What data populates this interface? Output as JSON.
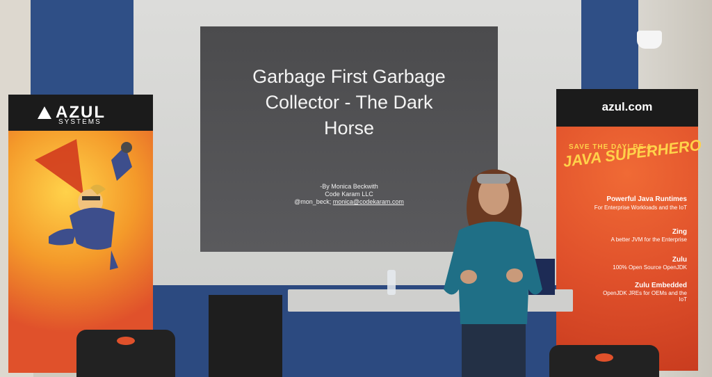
{
  "slide": {
    "title_lines": [
      "Garbage First Garbage",
      "Collector - The Dark",
      "Horse"
    ],
    "byline": "-By Monica Beckwith",
    "company": "Code Karam LLC",
    "handle": "@mon_beck; ",
    "email": "monica@codekaram.com"
  },
  "banner_left": {
    "logo": "AZUL",
    "logo_sub": "SYSTEMS"
  },
  "banner_right": {
    "url": "azul.com",
    "tagline": "SAVE THE DAY! BE A",
    "headline": "JAVA SUPERHERO",
    "runtime_heading": "Powerful Java Runtimes",
    "runtime_sub": "For Enterprise Workloads and the IoT",
    "zing_heading": "Zing",
    "zing_sub": "A better JVM for the Enterprise",
    "zulu_heading": "Zulu",
    "zulu_sub": "100% Open Source OpenJDK",
    "zulu_embedded_heading": "Zulu Embedded",
    "zulu_embedded_sub": "OpenJDK JREs for OEMs and the IoT"
  },
  "colors": {
    "azul_orange": "#e0512b",
    "banner_header": "#1b1b1b",
    "wall_blue": "#2f4f86",
    "slide_bg": "#4b4b4d",
    "sweater_teal": "#1f6f86"
  }
}
